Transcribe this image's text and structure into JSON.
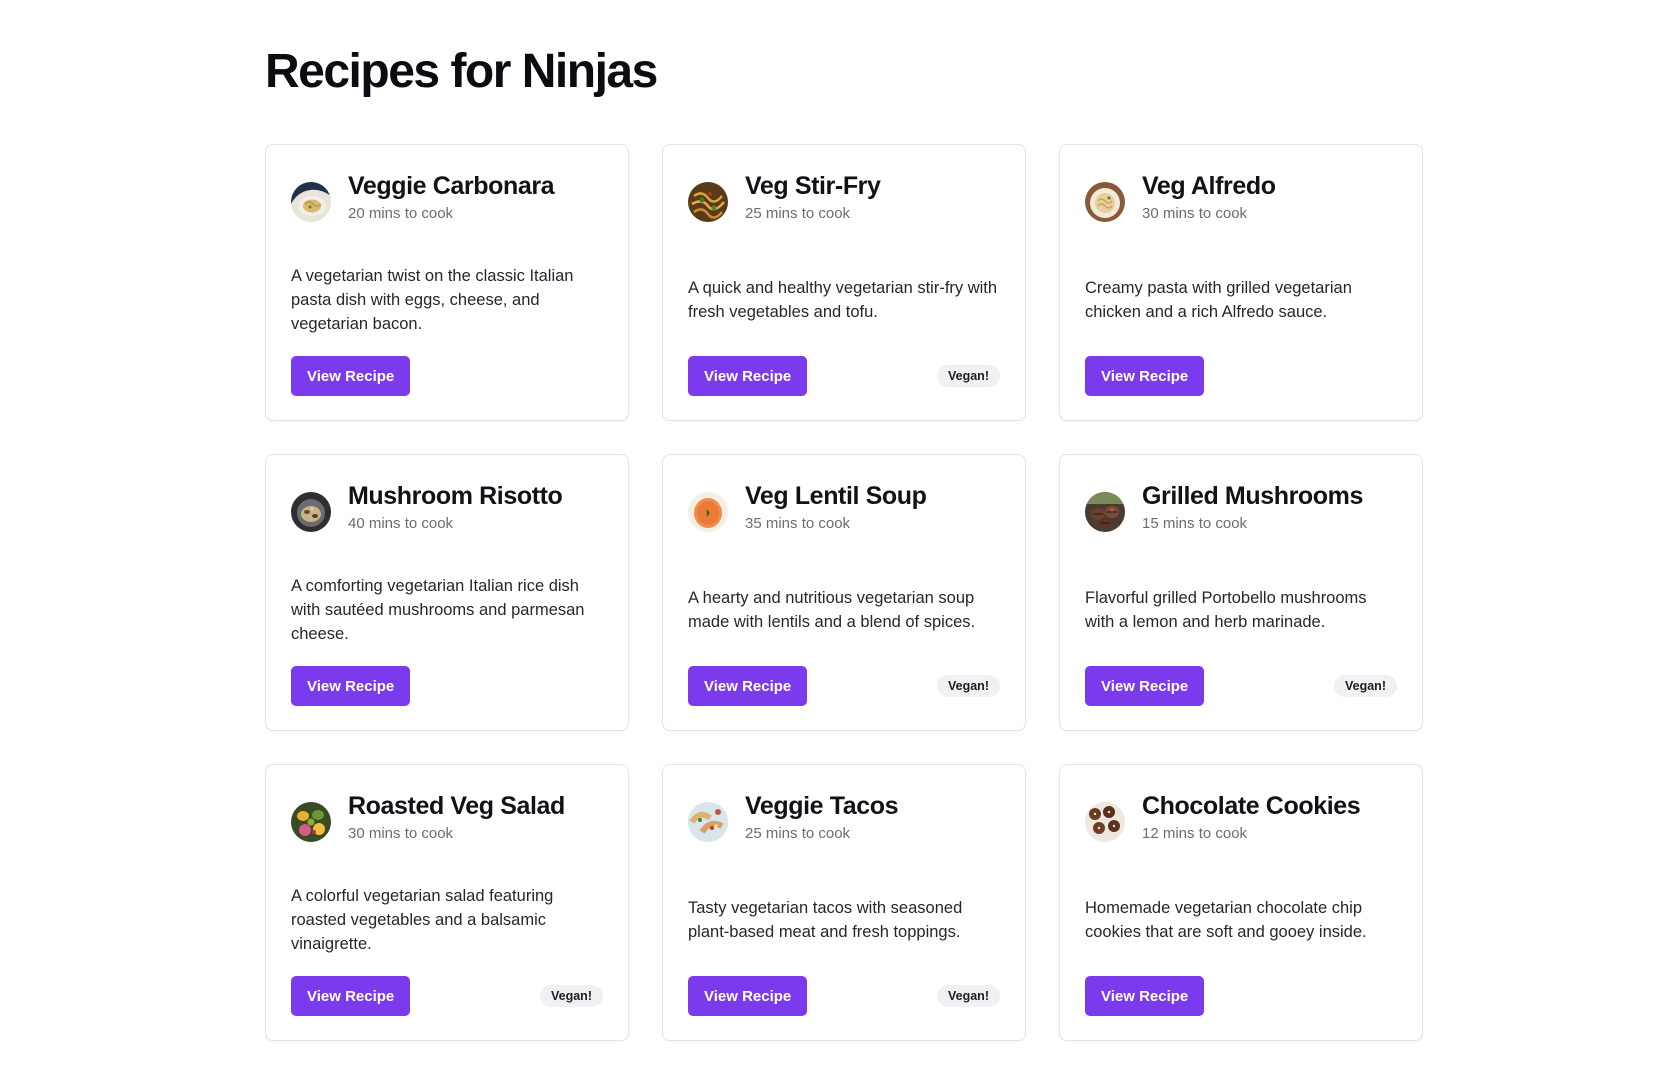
{
  "page": {
    "title": "Recipes for Ninjas"
  },
  "colors": {
    "accent": "#7c3aed",
    "badge_bg": "#f1f1f4"
  },
  "recipes": [
    {
      "title": "Veggie Carbonara",
      "time": "20 mins to cook",
      "description": "A vegetarian twist on the classic Italian pasta dish with eggs, cheese, and vegetarian bacon.",
      "button": "View Recipe",
      "badge": "",
      "thumb": "carbonara-thumbnail"
    },
    {
      "title": "Veg Stir-Fry",
      "time": "25 mins to cook",
      "description": "A quick and healthy vegetarian stir-fry with fresh vegetables and tofu.",
      "button": "View Recipe",
      "badge": "Vegan!",
      "thumb": "stir-fry-thumbnail"
    },
    {
      "title": "Veg Alfredo",
      "time": "30 mins to cook",
      "description": "Creamy pasta with grilled vegetarian chicken and a rich Alfredo sauce.",
      "button": "View Recipe",
      "badge": "",
      "thumb": "alfredo-thumbnail"
    },
    {
      "title": "Mushroom Risotto",
      "time": "40 mins to cook",
      "description": "A comforting vegetarian Italian rice dish with sautéed mushrooms and parmesan cheese.",
      "button": "View Recipe",
      "badge": "",
      "thumb": "risotto-thumbnail"
    },
    {
      "title": "Veg Lentil Soup",
      "time": "35 mins to cook",
      "description": "A hearty and nutritious vegetarian soup made with lentils and a blend of spices.",
      "button": "View Recipe",
      "badge": "Vegan!",
      "thumb": "lentil-soup-thumbnail"
    },
    {
      "title": "Grilled Mushrooms",
      "time": "15 mins to cook",
      "description": "Flavorful grilled Portobello mushrooms with a lemon and herb marinade.",
      "button": "View Recipe",
      "badge": "Vegan!",
      "thumb": "grilled-mushrooms-thumbnail"
    },
    {
      "title": "Roasted Veg Salad",
      "time": "30 mins to cook",
      "description": "A colorful vegetarian salad featuring roasted vegetables and a balsamic vinaigrette.",
      "button": "View Recipe",
      "badge": "Vegan!",
      "thumb": "salad-thumbnail"
    },
    {
      "title": "Veggie Tacos",
      "time": "25 mins to cook",
      "description": "Tasty vegetarian tacos with seasoned plant-based meat and fresh toppings.",
      "button": "View Recipe",
      "badge": "Vegan!",
      "thumb": "tacos-thumbnail"
    },
    {
      "title": "Chocolate Cookies",
      "time": "12 mins to cook",
      "description": "Homemade vegetarian chocolate chip cookies that are soft and gooey inside.",
      "button": "View Recipe",
      "badge": "",
      "thumb": "cookies-thumbnail"
    }
  ]
}
